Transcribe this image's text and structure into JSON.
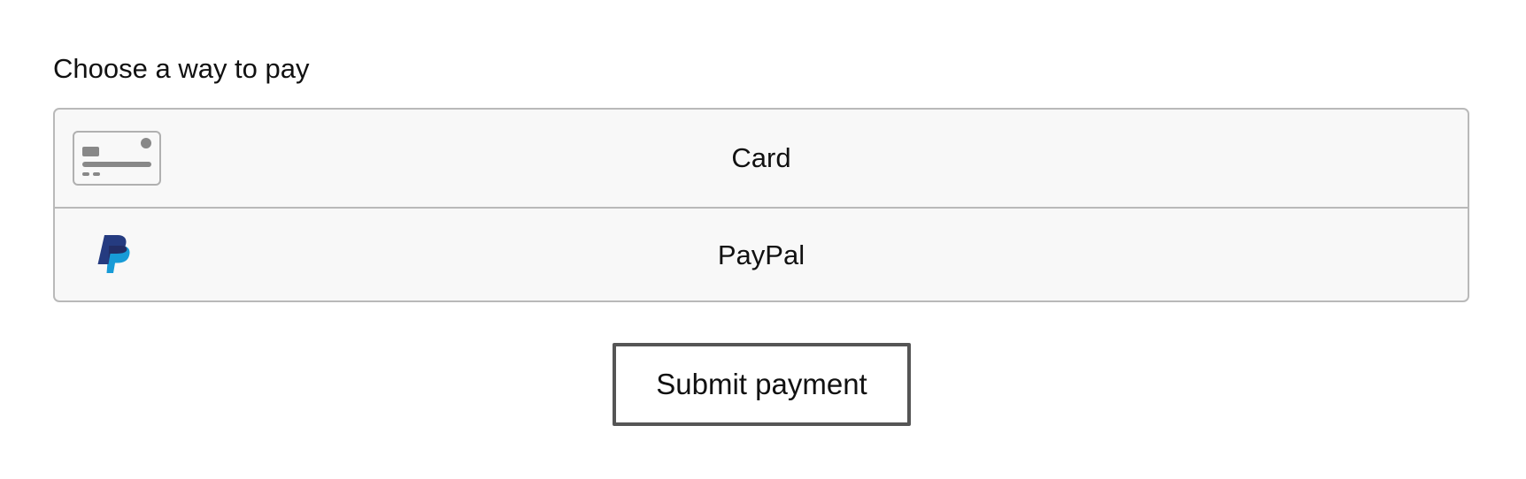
{
  "heading": "Choose a way to pay",
  "payment_methods": [
    {
      "label": "Card",
      "icon": "credit-card-icon"
    },
    {
      "label": "PayPal",
      "icon": "paypal-logo-icon"
    }
  ],
  "submit_label": "Submit payment",
  "colors": {
    "border": "#b9b9b9",
    "panel_background": "#f8f8f8",
    "card_icon_gray": "#888888",
    "paypal_dark_blue": "#253b80",
    "paypal_light_blue": "#179bd7",
    "button_border": "#555555"
  }
}
